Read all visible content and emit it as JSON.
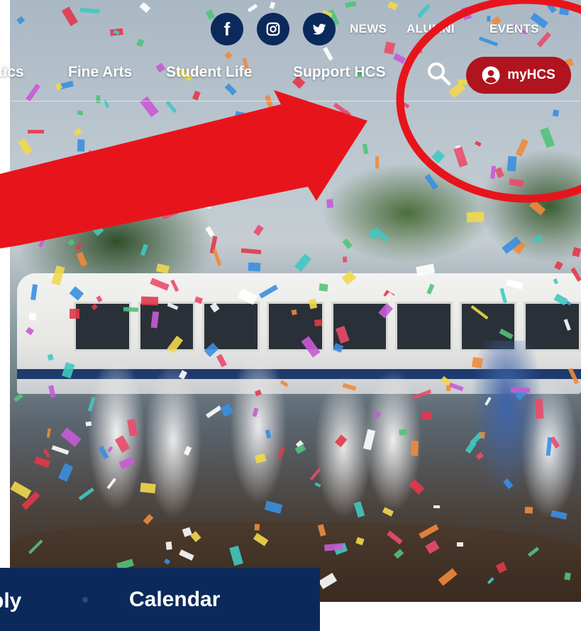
{
  "social": {
    "facebook_glyph": "f",
    "icons": [
      "facebook-icon",
      "instagram-icon",
      "twitter-icon"
    ]
  },
  "utility_nav": {
    "news": "NEWS",
    "alumni": "ALUMNI",
    "events": "EVENTS"
  },
  "main_nav": {
    "athletics": "Athletics",
    "fine_arts": "Fine Arts",
    "student_life": "Student Life",
    "support": "Support HCS"
  },
  "header_actions": {
    "search_icon": "search-icon",
    "login_label": "myHCS",
    "login_icon": "user-circle-icon"
  },
  "quick_links": {
    "apply": "Apply",
    "calendar": "Calendar"
  },
  "colors": {
    "navy": "#0b2a5b",
    "brand_red": "#b0141e",
    "annotation_red": "#e8141c"
  }
}
